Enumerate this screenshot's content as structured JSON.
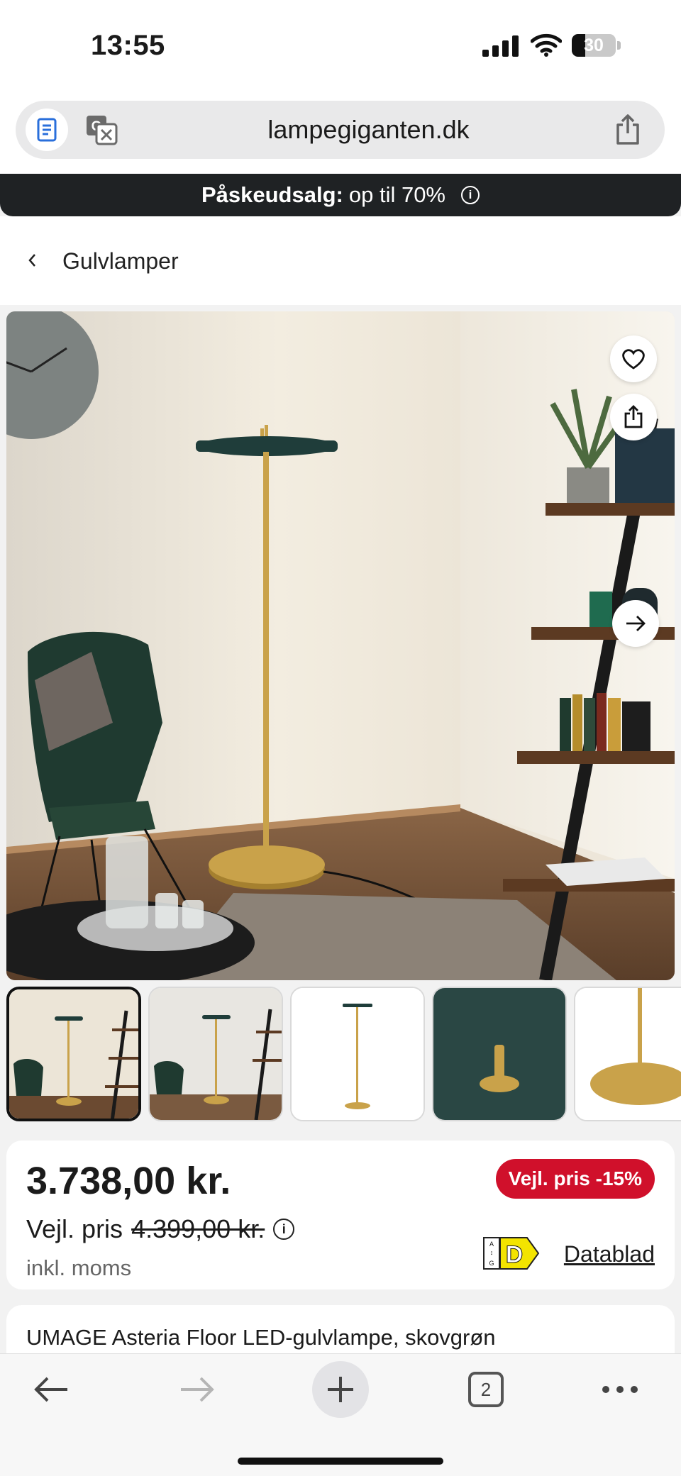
{
  "status_bar": {
    "time": "13:55",
    "battery_percent": "30",
    "battery_level": 0.3,
    "icons": [
      "cellular-signal-icon",
      "wifi-icon",
      "battery-icon"
    ]
  },
  "browser": {
    "url": "lampegiganten.dk",
    "icons": [
      "reader-icon",
      "translate-icon",
      "share-icon"
    ]
  },
  "promo": {
    "bold": "Påskeudsalg:",
    "text": "op til 70%",
    "info_icon": "i"
  },
  "breadcrumb": {
    "label": "Gulvlamper"
  },
  "gallery": {
    "thumbnail_count": 5,
    "active_index": 0,
    "icons": [
      "heart-icon",
      "share-icon",
      "arrow-right-icon"
    ]
  },
  "price": {
    "current": "3.738,00 kr.",
    "badge": "Vejl. pris -15%",
    "rrp_label": "Vejl. pris",
    "rrp_old": "4.399,00 kr.",
    "vat": "inkl. moms",
    "energy_class": "D",
    "energy_scale_top": "A",
    "energy_scale_bottom": "G",
    "datasheet": "Datablad"
  },
  "product": {
    "title": "UMAGE Asteria Floor LED-gulvlampe, skovgrøn"
  },
  "toolbar": {
    "tab_count": "2",
    "icons": [
      "back-arrow-icon",
      "forward-arrow-icon",
      "plus-icon",
      "tabs-icon",
      "more-icon"
    ]
  },
  "colors": {
    "promo_bg": "#1f2224",
    "badge_red": "#d0102b",
    "lamp_gold": "#c9a24a",
    "lamp_green": "#1f3d3a"
  }
}
